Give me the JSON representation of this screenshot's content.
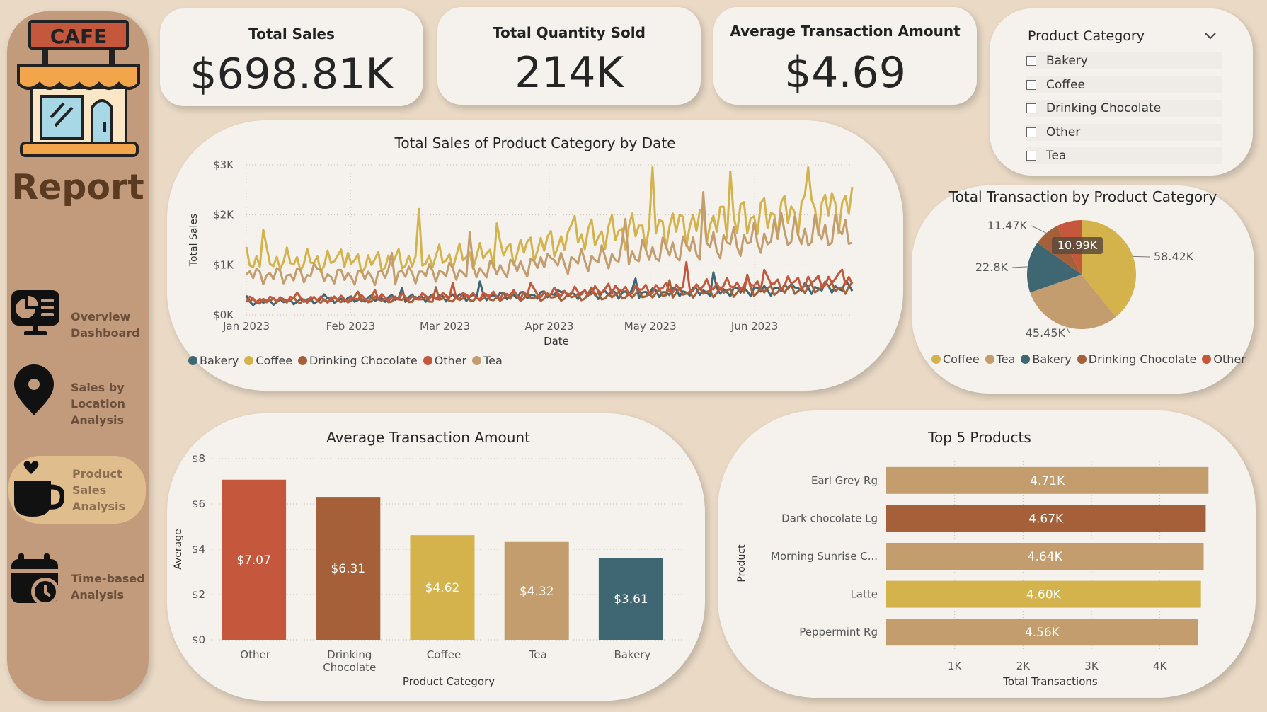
{
  "sidebar": {
    "logo_text": "CAFE",
    "title": "Report",
    "nav": [
      {
        "label": "Overview\nDashboard",
        "icon": "monitor-chart-icon"
      },
      {
        "label": "Sales by\nLocation\nAnalysis",
        "icon": "map-pin-icon"
      },
      {
        "label": "Product\nSales\nAnalysis",
        "icon": "coffee-cup-heart-icon",
        "active": true
      },
      {
        "label": "Time-based\nAnalysis",
        "icon": "calendar-clock-icon"
      }
    ]
  },
  "kpis": [
    {
      "title": "Total Sales",
      "value": "$698.81K"
    },
    {
      "title": "Total Quantity Sold",
      "value": "214K"
    },
    {
      "title": "Average Transaction Amount",
      "value": "$4.69"
    }
  ],
  "slicer": {
    "title": "Product Category",
    "options": [
      "Bakery",
      "Coffee",
      "Drinking Chocolate",
      "Other",
      "Tea"
    ]
  },
  "colors": {
    "bakery": "#3f6673",
    "coffee": "#d4b24c",
    "drinking_chocolate": "#a5603a",
    "other": "#c4573c",
    "tea": "#c39d6e"
  },
  "chart_data": [
    {
      "type": "line",
      "title": "Total Sales of Product Category by Date",
      "xlabel": "Date",
      "ylabel": "Total Sales",
      "x_range": [
        "2023-01-01",
        "2023-06-30"
      ],
      "x_ticks": [
        "Jan 2023",
        "Feb 2023",
        "Mar 2023",
        "Apr 2023",
        "May 2023",
        "Jun 2023"
      ],
      "y_ticks": [
        "$0K",
        "$1K",
        "$2K",
        "$3K"
      ],
      "ylim": [
        0,
        3000
      ],
      "grid": true,
      "legend": "bottom-left",
      "series": [
        {
          "name": "Bakery",
          "color": "#3f6673",
          "values": [
            250,
            320,
            380,
            430,
            480,
            560
          ]
        },
        {
          "name": "Coffee",
          "color": "#d4b24c",
          "values": [
            1100,
            1050,
            1200,
            1650,
            1900,
            2200
          ]
        },
        {
          "name": "Drinking Chocolate",
          "color": "#a5603a",
          "values": [
            280,
            300,
            330,
            380,
            470,
            540
          ]
        },
        {
          "name": "Other",
          "color": "#c4573c",
          "values": [
            300,
            330,
            390,
            480,
            600,
            700
          ]
        },
        {
          "name": "Tea",
          "color": "#c39d6e",
          "values": [
            800,
            780,
            900,
            1150,
            1450,
            1700
          ]
        }
      ]
    },
    {
      "type": "pie",
      "title": "Total Transaction by Product Category",
      "legend": "bottom",
      "slices": [
        {
          "name": "Coffee",
          "value": 58.42,
          "label": "58.42K",
          "color": "#d4b24c"
        },
        {
          "name": "Tea",
          "value": 45.45,
          "label": "45.45K",
          "color": "#c39d6e"
        },
        {
          "name": "Bakery",
          "value": 22.8,
          "label": "22.8K",
          "color": "#3f6673"
        },
        {
          "name": "Drinking Chocolate",
          "value": 11.47,
          "label": "11.47K",
          "color": "#a5603a"
        },
        {
          "name": "Other",
          "value": 10.99,
          "label": "10.99K",
          "color": "#c4573c"
        }
      ]
    },
    {
      "type": "bar",
      "title": "Average Transaction Amount",
      "xlabel": "Product Category",
      "ylabel": "Average",
      "categories": [
        "Other",
        "Drinking\nChocolate",
        "Coffee",
        "Tea",
        "Bakery"
      ],
      "values": [
        7.07,
        6.31,
        4.62,
        4.32,
        3.61
      ],
      "labels": [
        "$7.07",
        "$6.31",
        "$4.62",
        "$4.32",
        "$3.61"
      ],
      "colors": [
        "#c4573c",
        "#a5603a",
        "#d4b24c",
        "#c39d6e",
        "#3f6673"
      ],
      "y_ticks": [
        "$0",
        "$2",
        "$4",
        "$6",
        "$8"
      ],
      "ylim": [
        0,
        8
      ]
    },
    {
      "type": "bar",
      "orientation": "horizontal",
      "title": "Top 5 Products",
      "xlabel": "Total Transactions",
      "ylabel": "Product",
      "categories": [
        "Earl Grey Rg",
        "Dark chocolate Lg",
        "Morning Sunrise C...",
        "Latte",
        "Peppermint Rg"
      ],
      "values": [
        4710,
        4670,
        4640,
        4600,
        4560
      ],
      "labels": [
        "4.71K",
        "4.67K",
        "4.64K",
        "4.60K",
        "4.56K"
      ],
      "colors": [
        "#c39d6e",
        "#a5603a",
        "#c39d6e",
        "#d4b24c",
        "#c39d6e"
      ],
      "x_ticks": [
        "1K",
        "2K",
        "3K",
        "4K"
      ],
      "xlim": [
        0,
        4800
      ]
    }
  ]
}
